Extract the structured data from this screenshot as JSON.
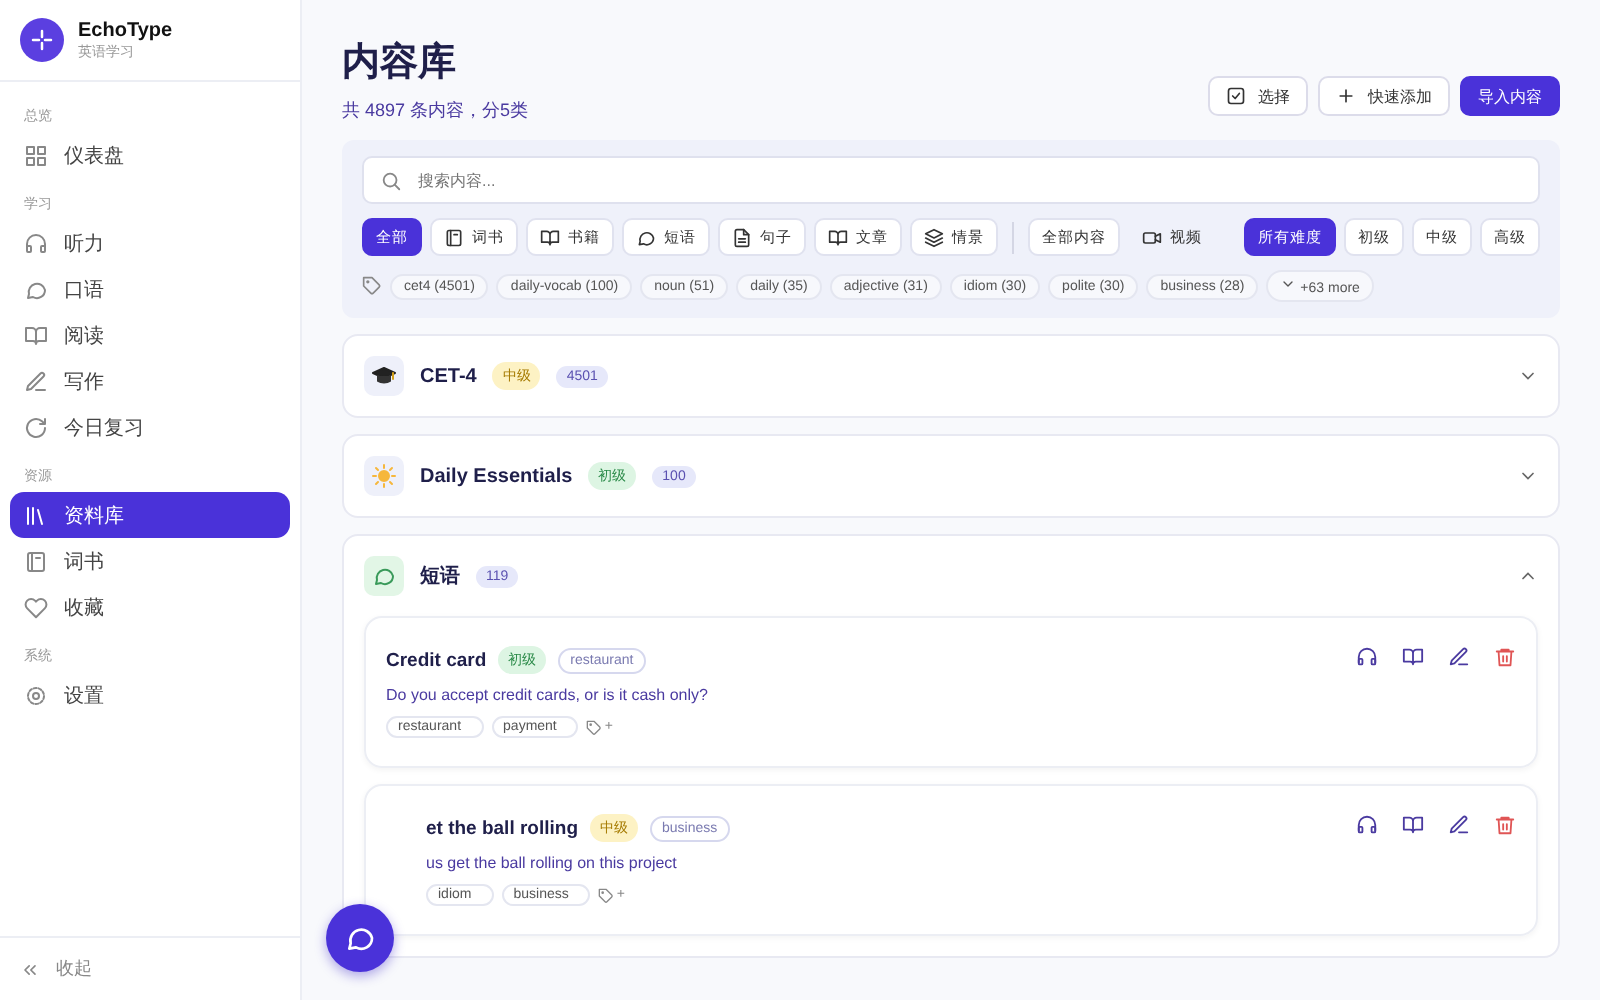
{
  "app": {
    "name": "EchoType",
    "subtitle": "英语学习"
  },
  "sidebar": {
    "groups": [
      {
        "label": "总览",
        "items": [
          {
            "label": "仪表盘",
            "selected": false
          }
        ]
      },
      {
        "label": "学习",
        "items": [
          {
            "label": "听力",
            "selected": false
          },
          {
            "label": "口语",
            "selected": false
          },
          {
            "label": "阅读",
            "selected": false
          },
          {
            "label": "写作",
            "selected": false
          },
          {
            "label": "今日复习",
            "selected": false
          }
        ]
      },
      {
        "label": "资源",
        "items": [
          {
            "label": "资料库",
            "selected": true
          },
          {
            "label": "词书",
            "selected": false
          },
          {
            "label": "收藏",
            "selected": false
          }
        ]
      },
      {
        "label": "系统",
        "items": [
          {
            "label": "设置",
            "selected": false
          }
        ]
      }
    ],
    "collapse": "收起"
  },
  "header": {
    "title": "内容库",
    "subtitle": "共 4897 条内容，分5类",
    "buttons": [
      {
        "label": "选择",
        "kind": "outline"
      },
      {
        "label": "快速添加",
        "kind": "outline"
      },
      {
        "label": "导入内容",
        "kind": "primary"
      }
    ]
  },
  "search": {
    "placeholder": "搜索内容..."
  },
  "type_filters": [
    {
      "label": "全部",
      "selected": true
    },
    {
      "label": "词书",
      "selected": false
    },
    {
      "label": "书籍",
      "selected": false
    },
    {
      "label": "短语",
      "selected": false
    },
    {
      "label": "句子",
      "selected": false
    },
    {
      "label": "文章",
      "selected": false
    },
    {
      "label": "情景",
      "selected": false
    }
  ],
  "media_filters": [
    {
      "label": "全部内容",
      "selected": true
    },
    {
      "label": "视频",
      "selected": false
    }
  ],
  "difficulty_filters": [
    {
      "label": "所有难度",
      "selected": true
    },
    {
      "label": "初级",
      "selected": false
    },
    {
      "label": "中级",
      "selected": false
    },
    {
      "label": "高级",
      "selected": false
    }
  ],
  "tags": [
    "cet4 (4501)",
    "daily-vocab (100)",
    "noun (51)",
    "daily (35)",
    "adjective (31)",
    "idiom (30)",
    "polite (30)",
    "business (28)"
  ],
  "more_tags": "+63 more",
  "sections": [
    {
      "title": "CET-4",
      "level": {
        "label": "中级",
        "color": "#fdf2c4"
      },
      "count": "4501",
      "expanded": false
    },
    {
      "title": "Daily Essentials",
      "level": {
        "label": "初级",
        "color": "#ddf5e3"
      },
      "count": "100",
      "expanded": false
    },
    {
      "title": "短语",
      "count": "119",
      "expanded": true,
      "items": [
        {
          "title": "Credit card",
          "level": {
            "label": "初级",
            "color": "#ddf5e3"
          },
          "category": "restaurant",
          "text": "Do you accept credit cards, or is it cash only?",
          "tags": [
            "restaurant",
            "payment"
          ],
          "add_tag": "+"
        },
        {
          "title": "et the ball rolling",
          "level": {
            "label": "中级",
            "color": "#fdf2c4"
          },
          "category": "business",
          "text": "us get the ball rolling on this project",
          "tags": [
            "idiom",
            "business"
          ],
          "add_tag": "+"
        }
      ]
    }
  ]
}
